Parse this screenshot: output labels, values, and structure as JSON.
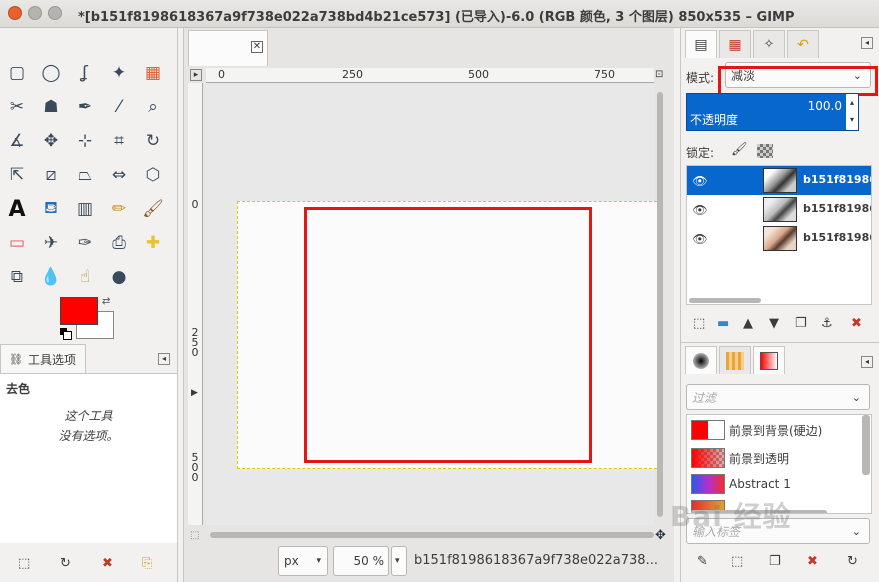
{
  "window": {
    "title": "*[b151f8198618367a9f738e022a738bd4b21ce573] (已导入)-6.0 (RGB 颜色, 3 个图层) 850x535 – GIMP"
  },
  "toolbox": {
    "fg_color": "#ff0000",
    "bg_color": "#ffffff",
    "tools": [
      "rect-select",
      "ellipse-select",
      "free-select",
      "fuzzy-select",
      "color-select",
      "scissors",
      "foreground-select",
      "paths",
      "color-picker",
      "zoom",
      "measure",
      "move",
      "align",
      "crop",
      "rotate",
      "scale",
      "shear",
      "perspective",
      "flip",
      "cage",
      "text",
      "bucket-fill",
      "blend",
      "pencil",
      "paintbrush",
      "eraser",
      "airbrush",
      "ink",
      "clone",
      "heal",
      "perspective-clone",
      "blur",
      "smudge",
      "dodge-burn"
    ],
    "options_tab_label": "工具选项",
    "options_title": "去色",
    "options_message_line1": "这个工具",
    "options_message_line2": "没有选项。"
  },
  "canvas": {
    "tab_close": "✕",
    "ruler_h": [
      "0",
      "250",
      "500",
      "750"
    ],
    "ruler_v": [
      [
        "0"
      ],
      [
        "2",
        "5",
        "0"
      ],
      [
        "5",
        "0",
        "0"
      ]
    ],
    "unit": "px",
    "zoom": "50 %",
    "status_text": "b151f8198618367a9f738e022a738..."
  },
  "dock": {
    "mode_label": "模式:",
    "mode_value": "减淡",
    "opacity_label": "不透明度",
    "opacity_value": "100.0",
    "lock_label": "锁定:",
    "layers": [
      {
        "name": "b151f81986",
        "selected": true
      },
      {
        "name": "b151f81986",
        "selected": false
      },
      {
        "name": "b151f81986",
        "selected": false
      }
    ],
    "filter_placeholder": "过滤",
    "gradients": [
      {
        "name": "前景到背景(硬边)"
      },
      {
        "name": "前景到透明"
      },
      {
        "name": "Abstract 1"
      }
    ],
    "tag_placeholder": "输入标签"
  },
  "watermark": "Bai 经验"
}
